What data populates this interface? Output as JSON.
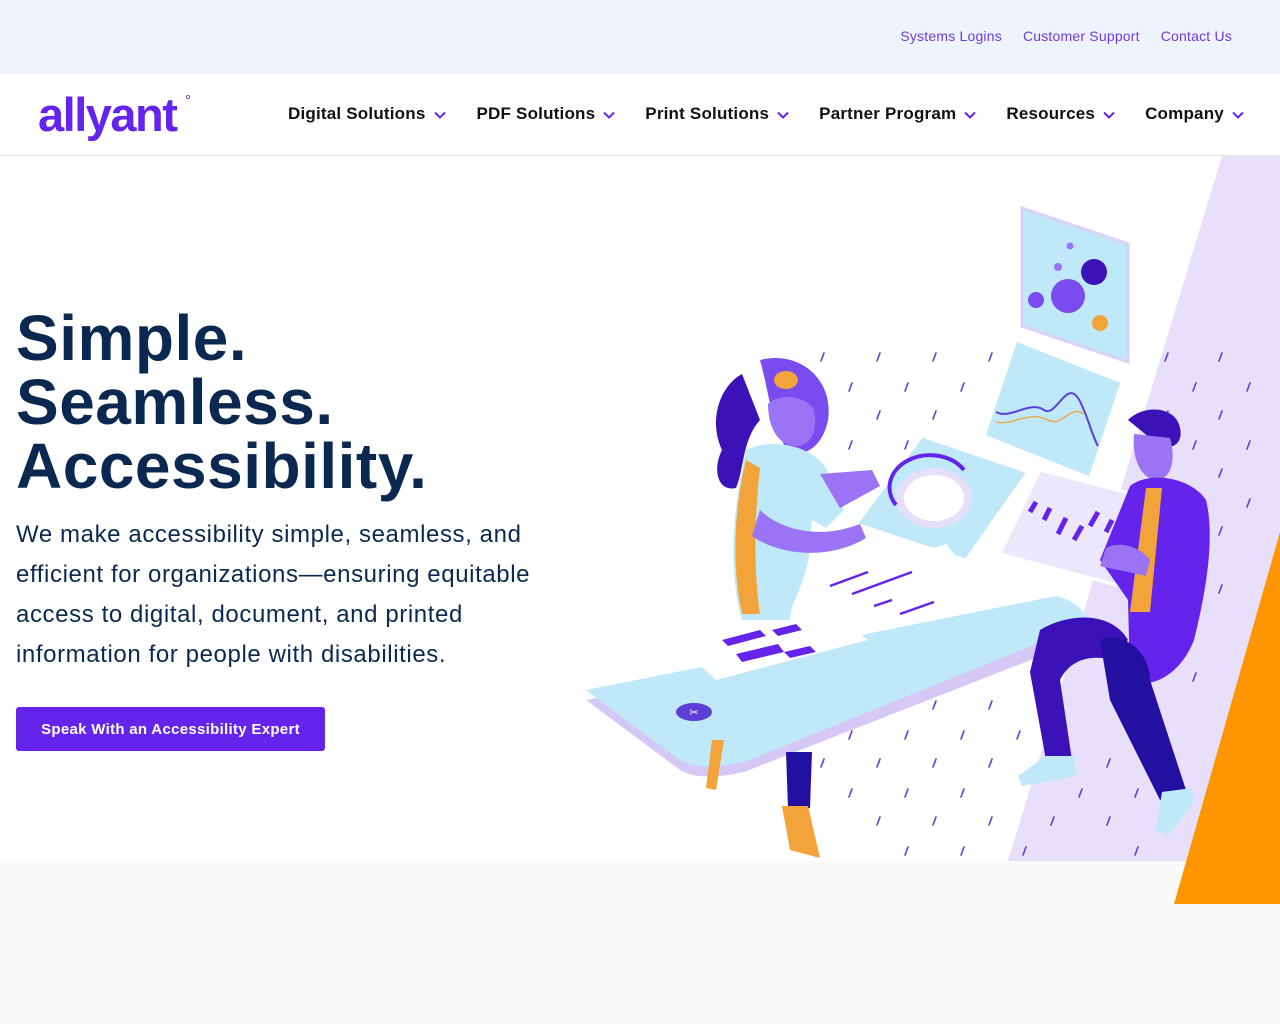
{
  "utility_links": [
    "Systems Logins",
    "Customer Support",
    "Contact Us"
  ],
  "brand": {
    "logo_text": "allyant",
    "primary": "#6424eb",
    "navy": "#0b2850",
    "accent_orange": "#ff9500",
    "lilac": "#e8e0fa"
  },
  "nav": {
    "items": [
      {
        "label": "Digital Solutions"
      },
      {
        "label": "PDF Solutions"
      },
      {
        "label": "Print Solutions"
      },
      {
        "label": "Partner Program"
      },
      {
        "label": "Resources"
      },
      {
        "label": "Company"
      }
    ],
    "chevron_icon": "chevron-down-icon"
  },
  "hero": {
    "title_lines": [
      "Simple.",
      "Seamless.",
      "Accessibility."
    ],
    "description": "We make accessibility simple, seamless, and efficient for organizations—ensuring equitable access to digital, document, and printed information for people with disabilities.",
    "cta_label": "Speak With an Accessibility Expert"
  }
}
